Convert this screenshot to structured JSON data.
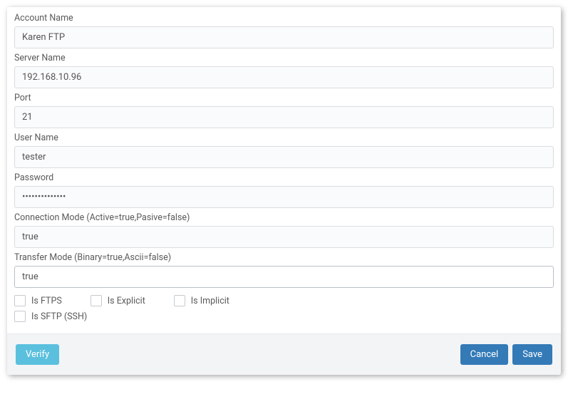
{
  "fields": {
    "accountName": {
      "label": "Account Name",
      "value": "Karen FTP"
    },
    "serverName": {
      "label": "Server Name",
      "value": "192.168.10.96"
    },
    "port": {
      "label": "Port",
      "value": "21"
    },
    "userName": {
      "label": "User Name",
      "value": "tester"
    },
    "password": {
      "label": "Password",
      "value": "••••••••••••••"
    },
    "connectionMode": {
      "label": "Connection Mode (Active=true,Pasive=false)",
      "value": "true"
    },
    "transferMode": {
      "label": "Transfer Mode (Binary=true,Ascii=false)",
      "value": "true"
    }
  },
  "checkboxes": {
    "isFtps": "Is FTPS",
    "isExplicit": "Is Explicit",
    "isImplicit": "Is Implicit",
    "isSftp": "Is SFTP (SSH)"
  },
  "buttons": {
    "verify": "Verify",
    "cancel": "Cancel",
    "save": "Save"
  }
}
